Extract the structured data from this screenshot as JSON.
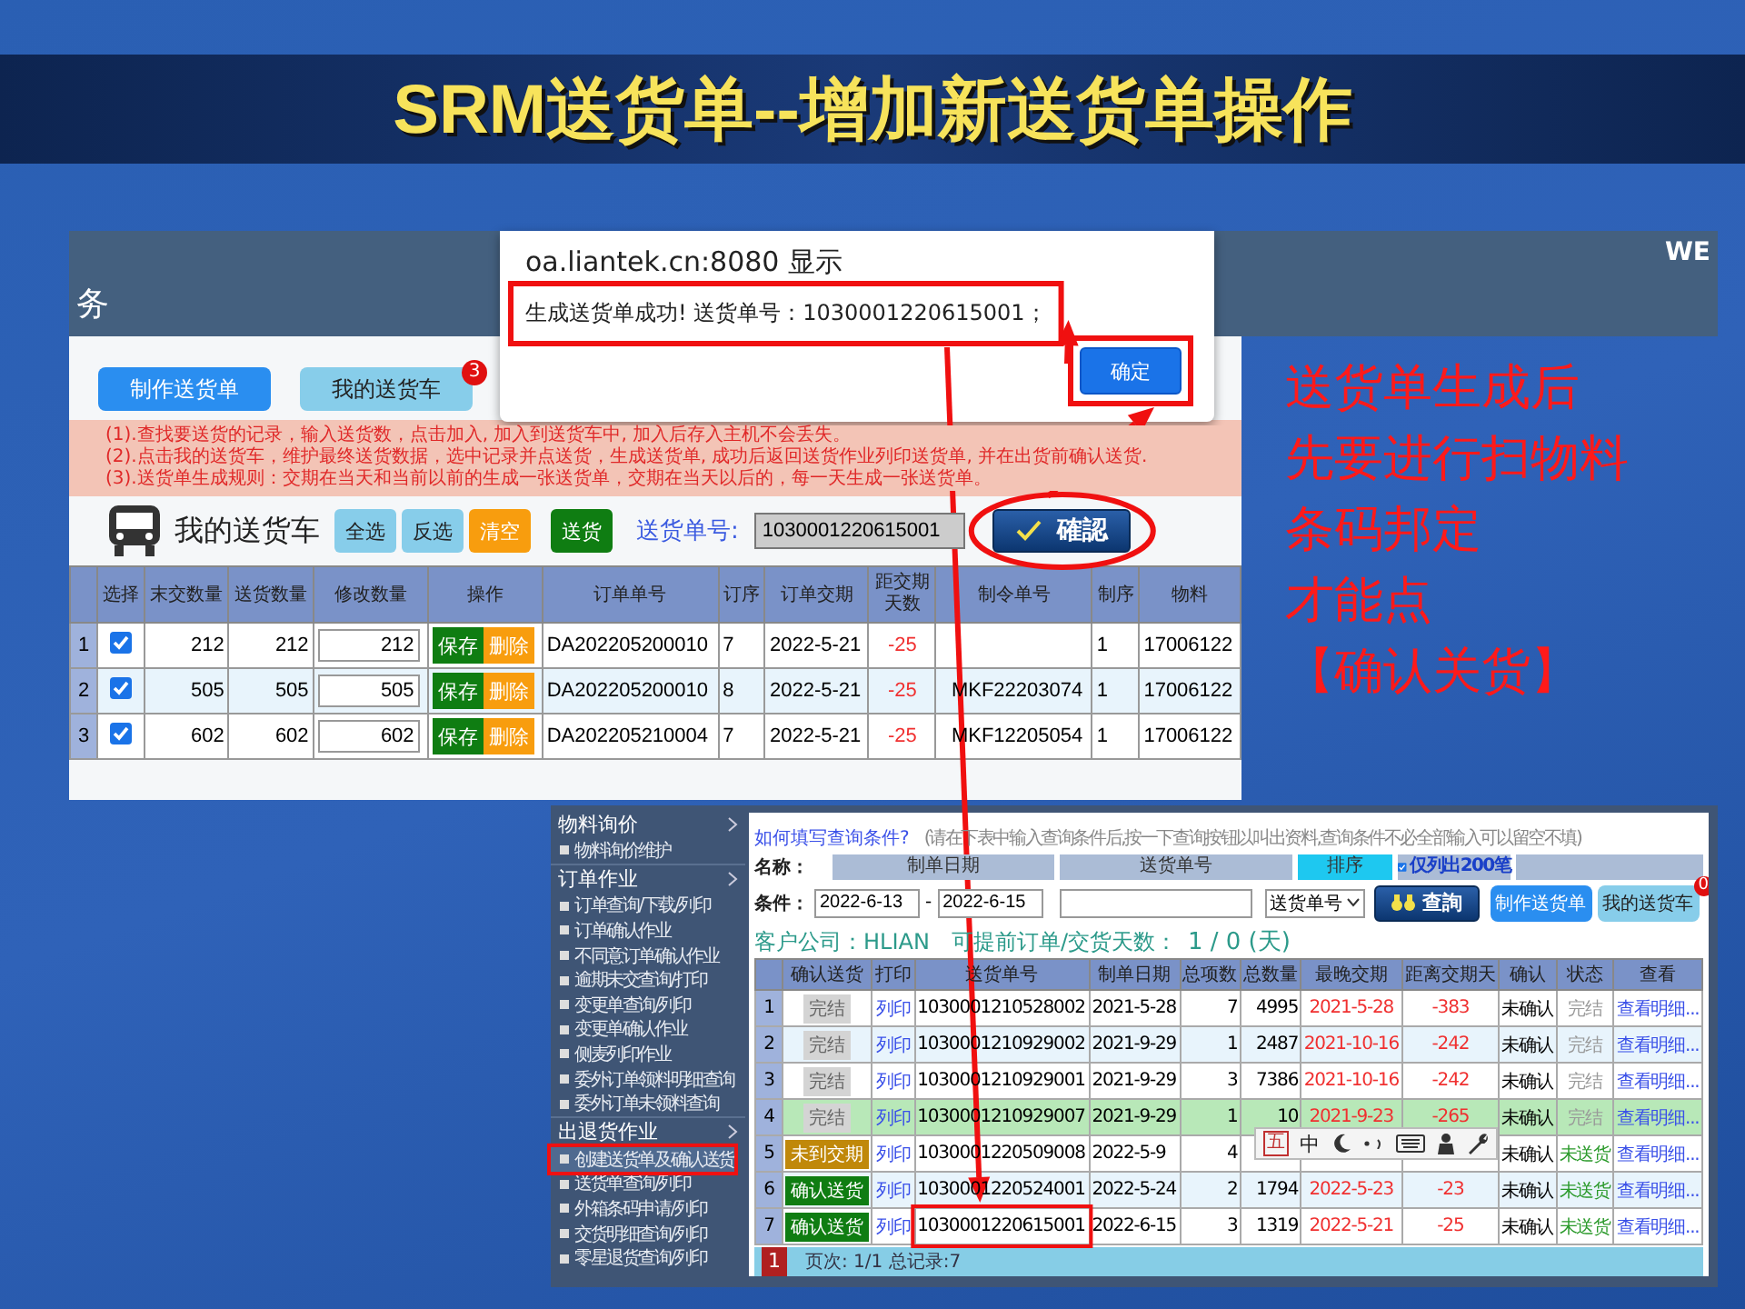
{
  "slide": {
    "title": "SRM送货单--增加新送货单操作"
  },
  "app_header": {
    "title_fragment": "务",
    "cut_text": "WE"
  },
  "dialog": {
    "origin": "oa.liantek.cn:8080 显示",
    "message": "生成送货单成功! 送货单号：1030001220615001；",
    "button": "确定"
  },
  "delivery_cart": {
    "tabs": [
      {
        "label": "制作送货单",
        "selected": true
      },
      {
        "label": "我的送货车",
        "selected": false,
        "badge": "3"
      }
    ],
    "notices": [
      "(1).查找要送货的记录，输入送货数，点击加入, 加入到送货车中, 加入后存入主机不会丢失。",
      "(2).点击我的送货车，维护最终送货数据，选中记录并点送货，生成送货单, 成功后返回送货作业列印送货单, 并在出货前确认送货.",
      "(3).送货单生成规则：交期在当天和当前以前的生成一张送货单，交期在当天以后的，每一天生成一张送货单。"
    ],
    "heading": "我的送货车",
    "actions": [
      {
        "label": "全选",
        "kind": "light"
      },
      {
        "label": "反选",
        "kind": "light"
      },
      {
        "label": "清空",
        "kind": "warning"
      },
      {
        "label": "送货",
        "kind": "success"
      }
    ],
    "number_label": "送货单号:",
    "number_value": "1030001220615001",
    "confirm_button": "確認",
    "columns": [
      "选择",
      "末交数量",
      "送货数量",
      "修改数量",
      "操作",
      "订单单号",
      "订序",
      "订单交期",
      "距交期天数",
      "制令单号",
      "制序",
      "物料"
    ],
    "rows": [
      {
        "index": "1",
        "checked": true,
        "unshipped": "212",
        "ship_qty": "212",
        "edit_qty": "212",
        "save": "保存",
        "delete": "删除",
        "order_no": "DA202205200010",
        "order_seq": "7",
        "order_due": "2022-5-21",
        "days_to_due": "-25",
        "work_seq": "1",
        "material": "17006122"
      },
      {
        "index": "2",
        "checked": true,
        "unshipped": "505",
        "ship_qty": "505",
        "edit_qty": "505",
        "save": "保存",
        "delete": "删除",
        "order_no": "DA202205200010",
        "order_seq": "8",
        "order_due": "2022-5-21",
        "days_to_due": "-25",
        "work_order": "MKF22203074",
        "work_seq": "1",
        "material": "17006122"
      },
      {
        "index": "3",
        "checked": true,
        "unshipped": "602",
        "ship_qty": "602",
        "edit_qty": "602",
        "save": "保存",
        "delete": "删除",
        "order_no": "DA202205210004",
        "order_seq": "7",
        "order_due": "2022-5-21",
        "days_to_due": "-25",
        "work_order": "MKF12205054",
        "work_seq": "1",
        "material": "17006122"
      }
    ]
  },
  "note": [
    "送货单生成后",
    "先要进行扫物料",
    "条码邦定",
    "才能点",
    "【确认关货】"
  ],
  "sidebar": {
    "sections": [
      {
        "title": "物料询价",
        "items": [
          {
            "label": "物料询价维护",
            "selected": false
          }
        ]
      },
      {
        "title": "订单作业",
        "items": [
          {
            "label": "订单查询/下载/列印",
            "selected": false
          },
          {
            "label": "订单确认作业",
            "selected": false
          },
          {
            "label": "不同意订单确认作业",
            "selected": false
          },
          {
            "label": "逾期未交查询/打印",
            "selected": false
          },
          {
            "label": "变更单查询/列印",
            "selected": false
          },
          {
            "label": "变更单确认作业",
            "selected": false
          },
          {
            "label": "侧麦列印作业",
            "selected": false
          },
          {
            "label": "委外订单领料明细查询",
            "selected": false
          },
          {
            "label": "委外订单未领料查询",
            "selected": false
          }
        ]
      },
      {
        "title": "出退货作业",
        "items": [
          {
            "label": "创建送货单及确认送货",
            "selected": true
          },
          {
            "label": "送货单查询/列印",
            "selected": false
          },
          {
            "label": "外箱条码申请/列印",
            "selected": false
          },
          {
            "label": "交货明细查询/列印",
            "selected": false
          },
          {
            "label": "零星退货查询/列印",
            "selected": false
          }
        ]
      }
    ]
  },
  "query": {
    "help_link": "如何填写查询条件?",
    "hint": "(请在下表中输入查询条件后,按一下查询按钮以叫出资料,查询条件不必全部输入可以留空不填)",
    "name_label": "名称：",
    "condition_label": "条件：",
    "field_headers": [
      "制单日期",
      "送货单号",
      "排序"
    ],
    "limit": {
      "label": "仅列出200笔",
      "checked": true
    },
    "date_from": "2022-6-13",
    "date_sep": "-",
    "date_to": "2022-6-15",
    "sort_select": "送货单号",
    "search_button": "查詢",
    "make_button": "制作送货单",
    "cart_button": "我的送货车",
    "cart_badge": "0"
  },
  "info": {
    "customer": "客户公司：HLIAN",
    "advance_label": "可提前订单/交货天数：",
    "advance_value": "1 / 0 (天)"
  },
  "shipments": {
    "columns": [
      "确认送货",
      "打印",
      "送货单号",
      "制单日期",
      "总项数",
      "总数量",
      "最晚交期",
      "距离交期天",
      "确认",
      "状态",
      "查看"
    ],
    "rows": [
      {
        "index": "1",
        "selected": false,
        "confirm": {
          "label": "完结",
          "kind": "done"
        },
        "print": "列印",
        "number": "1030001210528002",
        "date": "2021-5-28",
        "items": "7",
        "qty": "4995",
        "latest_due": "2021-5-28",
        "days": "-383",
        "confirmed": "未确认",
        "status": {
          "label": "完结",
          "kind": "closed"
        },
        "view": "查看明细..."
      },
      {
        "index": "2",
        "selected": false,
        "confirm": {
          "label": "完结",
          "kind": "done"
        },
        "print": "列印",
        "number": "1030001210929002",
        "date": "2021-9-29",
        "items": "1",
        "qty": "2487",
        "latest_due": "2021-10-16",
        "days": "-242",
        "confirmed": "未确认",
        "status": {
          "label": "完结",
          "kind": "closed"
        },
        "view": "查看明细..."
      },
      {
        "index": "3",
        "selected": false,
        "confirm": {
          "label": "完结",
          "kind": "done"
        },
        "print": "列印",
        "number": "1030001210929001",
        "date": "2021-9-29",
        "items": "3",
        "qty": "7386",
        "latest_due": "2021-10-16",
        "days": "-242",
        "confirmed": "未确认",
        "status": {
          "label": "完结",
          "kind": "closed"
        },
        "view": "查看明细..."
      },
      {
        "index": "4",
        "selected": true,
        "confirm": {
          "label": "完结",
          "kind": "done"
        },
        "print": "列印",
        "number": "1030001210929007",
        "date": "2021-9-29",
        "items": "1",
        "qty": "10",
        "latest_due": "2021-9-23",
        "days": "-265",
        "confirmed": "未确认",
        "status": {
          "label": "完结",
          "kind": "closed"
        },
        "view": "查看明细..."
      },
      {
        "index": "5",
        "selected": false,
        "confirm": {
          "label": "未到交期",
          "kind": "pending"
        },
        "print": "列印",
        "number": "1030001220509008",
        "date": "2022-5-9",
        "items": "4",
        "confirmed": "未确认",
        "status": {
          "label": "未送货",
          "kind": "unshipped"
        },
        "view": "查看明细..."
      },
      {
        "index": "6",
        "selected": false,
        "confirm": {
          "label": "确认送货",
          "kind": "confirm"
        },
        "print": "列印",
        "number": "1030001220524001",
        "date": "2022-5-24",
        "items": "2",
        "qty": "1794",
        "latest_due": "2022-5-23",
        "days": "-23",
        "confirmed": "未确认",
        "status": {
          "label": "未送货",
          "kind": "unshipped"
        },
        "view": "查看明细..."
      },
      {
        "index": "7",
        "selected": false,
        "confirm": {
          "label": "确认送货",
          "kind": "confirm"
        },
        "print": "列印",
        "number": "1030001220615001",
        "date": "2022-6-15",
        "items": "3",
        "qty": "1319",
        "latest_due": "2022-5-21",
        "days": "-25",
        "confirmed": "未确认",
        "status": {
          "label": "未送货",
          "kind": "unshipped"
        },
        "view": "查看明细..."
      }
    ],
    "pager": {
      "page": "1",
      "text": "页次: 1/1 总记录:7"
    }
  },
  "ime_toolbar": {
    "glyphs": [
      "五",
      "中"
    ]
  }
}
